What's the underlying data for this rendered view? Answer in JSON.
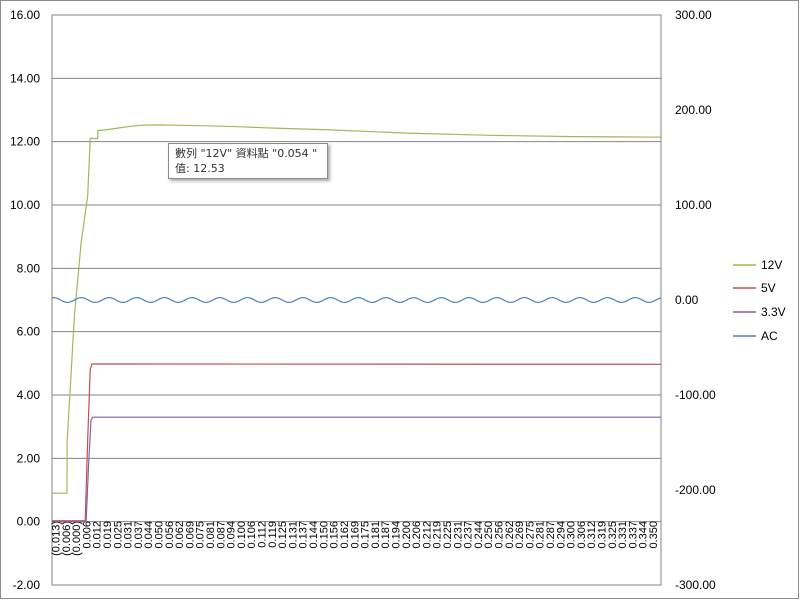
{
  "tooltip": {
    "line1": "數列 \"12V\" 資料點 \"0.054 \"",
    "line2": "值: 12.53"
  },
  "chart_data": {
    "type": "line",
    "title": "",
    "xlabel": "",
    "ylabel": "",
    "y_left": {
      "ylim": [
        -2,
        16
      ],
      "ticks": [
        "-2.00",
        "0.00",
        "2.00",
        "4.00",
        "6.00",
        "8.00",
        "10.00",
        "12.00",
        "14.00",
        "16.00"
      ]
    },
    "y_right": {
      "ylim": [
        -300,
        300
      ],
      "ticks": [
        "-300.00",
        "-200.00",
        "-100.00",
        "0.00",
        "100.00",
        "200.00",
        "300.00"
      ]
    },
    "grid": true,
    "legend_position": "right",
    "categories": [
      "(0.013)",
      "(0.006)",
      "(0.000)",
      "0.006",
      "0.012",
      "0.019",
      "0.025",
      "0.031",
      "0.037",
      "0.044",
      "0.050",
      "0.056",
      "0.062",
      "0.069",
      "0.075",
      "0.081",
      "0.087",
      "0.094",
      "0.100",
      "0.106",
      "0.112",
      "0.119",
      "0.125",
      "0.131",
      "0.137",
      "0.144",
      "0.150",
      "0.156",
      "0.162",
      "0.169",
      "0.175",
      "0.181",
      "0.187",
      "0.194",
      "0.200",
      "0.206",
      "0.212",
      "0.219",
      "0.225",
      "0.231",
      "0.237",
      "0.244",
      "0.250",
      "0.256",
      "0.262",
      "0.269",
      "0.275",
      "0.281",
      "0.287",
      "0.294",
      "0.300",
      "0.306",
      "0.312",
      "0.319",
      "0.325",
      "0.331",
      "0.337",
      "0.344",
      "0.350"
    ],
    "series": [
      {
        "name": "12V",
        "axis": "left",
        "color": "#9bbb59",
        "x": [
          -0.0135,
          -0.0045,
          -0.0044,
          0.0,
          0.004,
          0.008,
          0.0095,
          0.014,
          0.0141,
          0.02,
          0.03,
          0.04,
          0.05,
          0.06,
          0.08,
          0.1,
          0.12,
          0.15,
          0.2,
          0.25,
          0.3,
          0.353
        ],
        "y": [
          0.9,
          0.9,
          2.5,
          6.5,
          8.8,
          10.3,
          12.1,
          12.1,
          12.35,
          12.38,
          12.46,
          12.52,
          12.53,
          12.52,
          12.5,
          12.47,
          12.43,
          12.38,
          12.27,
          12.2,
          12.16,
          12.14
        ]
      },
      {
        "name": "5V",
        "axis": "left",
        "color": "#c0504d",
        "x": [
          -0.0135,
          0.0065,
          0.008,
          0.0095,
          0.0105,
          0.353
        ],
        "y": [
          0.03,
          0.03,
          2.6,
          4.8,
          4.98,
          4.97
        ]
      },
      {
        "name": "3.3V",
        "axis": "left",
        "color": "#8064a2",
        "x": [
          -0.0135,
          0.007,
          0.0085,
          0.01,
          0.011,
          0.353
        ],
        "y": [
          0.0,
          0.0,
          1.8,
          3.2,
          3.3,
          3.3
        ]
      },
      {
        "name": "AC",
        "axis": "right",
        "color": "#4f81bd",
        "waveform": "sine",
        "amplitude": 2.5,
        "offset": 0.0,
        "frequency_hz": 60,
        "x_range": [
          -0.0135,
          0.353
        ]
      }
    ]
  }
}
